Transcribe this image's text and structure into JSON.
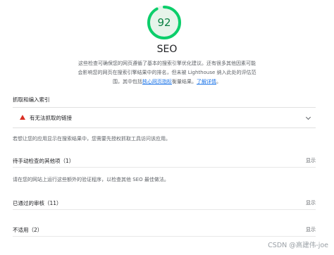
{
  "score": {
    "value": "92",
    "fraction": 0.92,
    "color": "#0cce6b",
    "track_color": "#e6f4ea"
  },
  "category": {
    "title": "SEO",
    "description_1": "这些检查可确保您的网页遵循了基本的搜索引擎优化建议。还有很多其他因素可能会影响您的网页在搜索引擎结果中的排名，但未被 Lighthouse 纳入此处的评估范围，其中包括",
    "description_link_1": "核心网页指标",
    "description_2": "衡量结果。",
    "description_link_2": "了解详情"
  },
  "crawl_group": {
    "title": "抓取和编入索引",
    "failed_audit": {
      "label": "有无法抓取的链接",
      "icon": "fail-triangle-icon",
      "status_color": "#d93025"
    },
    "note": "若想让您的应用显示在搜索结果中，您需要先授权抓取工具访问该应用。"
  },
  "manual": {
    "title": "待手动检查的其他项（1）",
    "toggle": "显示",
    "note": "请在您的网站上运行这些额外的验证程序，以检查其他 SEO 最佳做法。"
  },
  "passed": {
    "title": "已通过的审核（11）",
    "toggle": "显示"
  },
  "not_applicable": {
    "title": "不适用（2）",
    "toggle": "显示"
  },
  "watermark": "CSDN @高建伟-joe"
}
